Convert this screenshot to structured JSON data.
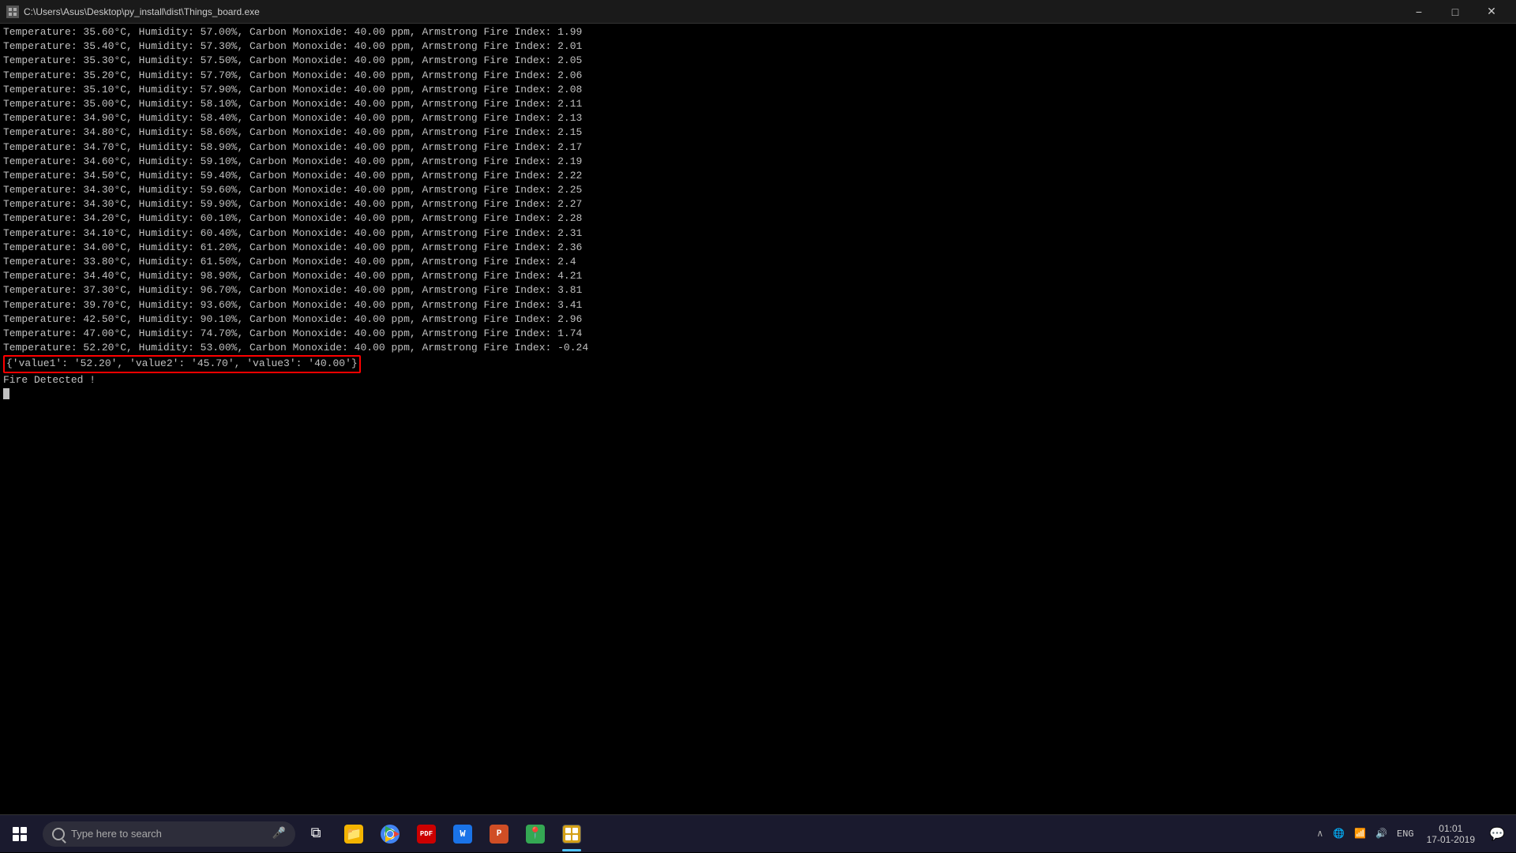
{
  "titlebar": {
    "title": "C:\\Users\\Asus\\Desktop\\py_install\\dist\\Things_board.exe",
    "minimize_label": "−",
    "maximize_label": "□",
    "close_label": "✕"
  },
  "console": {
    "lines": [
      "Temperature: 35.60°C, Humidity: 57.00%, Carbon Monoxide:  40.00 ppm, Armstrong Fire Index:  1.99",
      "Temperature: 35.40°C, Humidity: 57.30%, Carbon Monoxide:  40.00 ppm, Armstrong Fire Index:  2.01",
      "Temperature: 35.30°C, Humidity: 57.50%, Carbon Monoxide:  40.00 ppm, Armstrong Fire Index:  2.05",
      "Temperature: 35.20°C, Humidity: 57.70%, Carbon Monoxide:  40.00 ppm, Armstrong Fire Index:  2.06",
      "Temperature: 35.10°C, Humidity: 57.90%, Carbon Monoxide:  40.00 ppm, Armstrong Fire Index:  2.08",
      "Temperature: 35.00°C, Humidity: 58.10%, Carbon Monoxide:  40.00 ppm, Armstrong Fire Index:  2.11",
      "Temperature: 34.90°C, Humidity: 58.40%, Carbon Monoxide:  40.00 ppm, Armstrong Fire Index:  2.13",
      "Temperature: 34.80°C, Humidity: 58.60%, Carbon Monoxide:  40.00 ppm, Armstrong Fire Index:  2.15",
      "Temperature: 34.70°C, Humidity: 58.90%, Carbon Monoxide:  40.00 ppm, Armstrong Fire Index:  2.17",
      "Temperature: 34.60°C, Humidity: 59.10%, Carbon Monoxide:  40.00 ppm, Armstrong Fire Index:  2.19",
      "Temperature: 34.50°C, Humidity: 59.40%, Carbon Monoxide:  40.00 ppm, Armstrong Fire Index:  2.22",
      "Temperature: 34.30°C, Humidity: 59.60%, Carbon Monoxide:  40.00 ppm, Armstrong Fire Index:  2.25",
      "Temperature: 34.30°C, Humidity: 59.90%, Carbon Monoxide:  40.00 ppm, Armstrong Fire Index:  2.27",
      "Temperature: 34.20°C, Humidity: 60.10%, Carbon Monoxide:  40.00 ppm, Armstrong Fire Index:  2.28",
      "Temperature: 34.10°C, Humidity: 60.40%, Carbon Monoxide:  40.00 ppm, Armstrong Fire Index:  2.31",
      "Temperature: 34.00°C, Humidity: 61.20%, Carbon Monoxide:  40.00 ppm, Armstrong Fire Index:  2.36",
      "Temperature: 33.80°C, Humidity: 61.50%, Carbon Monoxide:  40.00 ppm, Armstrong Fire Index:  2.4",
      "Temperature: 34.40°C, Humidity: 98.90%, Carbon Monoxide:  40.00 ppm, Armstrong Fire Index:  4.21",
      "Temperature: 37.30°C, Humidity: 96.70%, Carbon Monoxide:  40.00 ppm, Armstrong Fire Index:  3.81",
      "Temperature: 39.70°C, Humidity: 93.60%, Carbon Monoxide:  40.00 ppm, Armstrong Fire Index:  3.41",
      "Temperature: 42.50°C, Humidity: 90.10%, Carbon Monoxide:  40.00 ppm, Armstrong Fire Index:  2.96",
      "Temperature: 47.00°C, Humidity: 74.70%, Carbon Monoxide:  40.00 ppm, Armstrong Fire Index:  1.74",
      "Temperature: 52.20°C, Humidity: 53.00%, Carbon Monoxide:  40.00 ppm, Armstrong Fire Index: -0.24"
    ],
    "highlighted_line": "{'value1': '52.20', 'value2': '45.70', 'value3': '40.00'}",
    "fire_detected": "Fire Detected !"
  },
  "taskbar": {
    "search_placeholder": "Type here to search",
    "clock_time": "01:01",
    "clock_date": "17-01-2019",
    "language": "ENG",
    "apps": [
      {
        "name": "File Explorer",
        "icon": "📁",
        "active": false
      },
      {
        "name": "Chrome",
        "icon": "●",
        "active": false
      },
      {
        "name": "Adobe Reader",
        "icon": "A",
        "active": false
      },
      {
        "name": "Word",
        "icon": "W",
        "active": false
      },
      {
        "name": "PowerPoint",
        "icon": "P",
        "active": false
      },
      {
        "name": "Maps",
        "icon": "◉",
        "active": false
      },
      {
        "name": "Things Board",
        "icon": "⬛",
        "active": true
      }
    ]
  }
}
